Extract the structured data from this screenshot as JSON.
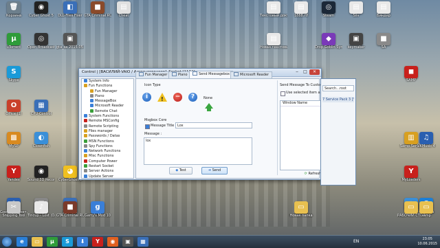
{
  "desktop": {
    "icons": [
      {
        "label": "Корзина",
        "color": "#6d7f8c",
        "glyph": "🗑"
      },
      {
        "label": "Cyber Ghost 5",
        "color": "#222222",
        "glyph": "◉"
      },
      {
        "label": "DLL-Files Fixer",
        "color": "#3a6fb8",
        "glyph": "◧"
      },
      {
        "label": "GTA Criminal RUSSIA",
        "color": "#8a4a2a",
        "glyph": "■"
      },
      {
        "label": "Cheat",
        "color": "#e0e0e0",
        "glyph": "▤"
      },
      {
        "label": "uTorrent",
        "color": "#2f9c3a",
        "glyph": "µ"
      },
      {
        "label": "Skype",
        "color": "#1a9ad8",
        "glyph": "S"
      },
      {
        "label": "Open Broadcast...",
        "color": "#333333",
        "glyph": "◎"
      },
      {
        "label": "gta_sa 2015-05-01 ...",
        "color": "#555555",
        "glyph": "▣"
      },
      {
        "label": "Office (1)",
        "color": "#c9402a",
        "glyph": "O"
      },
      {
        "label": "CPU-Control",
        "color": "#3a6fb8",
        "glyph": "▦"
      },
      {
        "label": "MySP",
        "color": "#d88a20",
        "glyph": "▩"
      },
      {
        "label": "Clownfish",
        "color": "#3a8fd8",
        "glyph": "◐"
      },
      {
        "label": "Yandex",
        "color": "#c8201c",
        "glyph": "Y"
      },
      {
        "label": "Sound 3D Record",
        "color": "#222222",
        "glyph": "◉"
      },
      {
        "label": "CyberGhost 5",
        "color": "#f0c020",
        "glyph": "◕"
      },
      {
        "label": "Google Планет...",
        "color": "#2a5fb0",
        "glyph": "◍"
      },
      {
        "label": "m1dge",
        "color": "#888888",
        "glyph": "■"
      },
      {
        "label": "JetBoost",
        "color": "#3a6fb8",
        "glyph": "➤"
      },
      {
        "label": "Snipping Tool",
        "color": "#c8c8c8",
        "glyph": "✂"
      },
      {
        "label": "Tincup - Lost (Original M...",
        "color": "#e8e8e8",
        "glyph": "♪"
      },
      {
        "label": "GTA Criminal RUSSIA.exe",
        "color": "#7a3a2a",
        "glyph": "■"
      },
      {
        "label": "Garry's Mod 10",
        "color": "#3a7fd8",
        "glyph": "g"
      },
      {
        "label": "Текстовый документ...",
        "color": "#e8e8e8",
        "glyph": "▤"
      },
      {
        "label": "Новая текстовый...",
        "color": "#e8e8e8",
        "glyph": "▤"
      },
      {
        "label": "1888.rtf",
        "color": "#e8e8e8",
        "glyph": "▤"
      },
      {
        "label": "Steam",
        "color": "#1b2838",
        "glyph": "◎"
      },
      {
        "label": "Drop Goblin Synchronic...",
        "color": "#7a3ab8",
        "glyph": "◆"
      },
      {
        "label": "keymaker",
        "color": "#444444",
        "glyph": "▣"
      },
      {
        "label": "SA",
        "color": "#8a8a8a",
        "glyph": "■"
      },
      {
        "label": "Siiv",
        "color": "#e8e8e8",
        "glyph": "▤"
      },
      {
        "label": "Биндер",
        "color": "#e8e8e8",
        "glyph": "▤"
      },
      {
        "label": "SAMP",
        "color": "#c8201c",
        "glyph": "◼"
      },
      {
        "label": "Samp Server",
        "color": "#d8a020",
        "glyph": "▥"
      },
      {
        "label": "MyLoaders",
        "color": "#c8201c",
        "glyph": "Y"
      },
      {
        "label": "Wifi",
        "color": "#3a8fd8",
        "glyph": "◈"
      },
      {
        "label": "VKMusic 4",
        "color": "#2a5fb0",
        "glyph": "♫"
      },
      {
        "label": "@mail.ru",
        "color": "#1a7fd8",
        "glyph": "@"
      },
      {
        "label": "Новая папка",
        "color": "#e8c050",
        "glyph": "▭"
      },
      {
        "label": "РАБОЧИЙ СТОЛ",
        "color": "#e8c050",
        "glyph": "▭"
      },
      {
        "label": "samp",
        "color": "#e8c050",
        "glyph": "▭"
      }
    ]
  },
  "window": {
    "title": "Control | [ВАСИЛИЙ-VAIO / Администратор]_Socket [1184]",
    "min_glyph": "‒",
    "max_glyph": "□",
    "close_glyph": "✕",
    "tree": [
      {
        "label": "System Info",
        "level": 0,
        "color": "#3a7fd8"
      },
      {
        "label": "Fun Functions",
        "level": 0,
        "color": "#d8a020"
      },
      {
        "label": "Fun Manager",
        "level": 1,
        "color": "#d8a020"
      },
      {
        "label": "Piano",
        "level": 1,
        "color": "#888888"
      },
      {
        "label": "MessageBox",
        "level": 1,
        "color": "#3a7fd8"
      },
      {
        "label": "Microsoft Reader",
        "level": 1,
        "color": "#3a7fd8"
      },
      {
        "label": "Remote Chat",
        "level": 1,
        "color": "#3a9f3a"
      },
      {
        "label": "System Functions",
        "level": 0,
        "color": "#3a7fd8"
      },
      {
        "label": "Remote MSConfig",
        "level": 0,
        "color": "#c8201c"
      },
      {
        "label": "Remote Scripting",
        "level": 0,
        "color": "#888888"
      },
      {
        "label": "Files manager",
        "level": 0,
        "color": "#d8a020"
      },
      {
        "label": "Passwords / Datas",
        "level": 0,
        "color": "#d8a020"
      },
      {
        "label": "MSN Functions",
        "level": 0,
        "color": "#3a9f3a"
      },
      {
        "label": "Spy Functions",
        "level": 0,
        "color": "#888888"
      },
      {
        "label": "Network Functions",
        "level": 0,
        "color": "#3a7fd8"
      },
      {
        "label": "Misc Functions",
        "level": 0,
        "color": "#d8a020"
      },
      {
        "label": "Computer Power",
        "level": 0,
        "color": "#c8201c"
      },
      {
        "label": "Restart Socket",
        "level": 0,
        "color": "#3a9f3a"
      },
      {
        "label": "Server Actions",
        "level": 0,
        "color": "#888888"
      },
      {
        "label": "Update Server",
        "level": 0,
        "color": "#3a7fd8"
      }
    ],
    "tabs": [
      "Fun Manager",
      "Piano",
      "Send Messagebox",
      "Microsoft Reader"
    ],
    "active_tab": 2,
    "panel": {
      "icon_type_label": "Icon Type",
      "icons": [
        "i",
        "!",
        "−",
        "?"
      ],
      "none_label": "None",
      "msgbox_core_label": "Msgbox Core",
      "message_title_label": "Message Title :",
      "message_title_value": "Lox",
      "message_label": "Message :",
      "message_value": "lox",
      "test_label": "Test",
      "send_label": "Send",
      "custom_window_label": "Send Message To Custom Window",
      "use_selected_label": "Use selected item as message window",
      "window_name_header": "Window Name",
      "refresh_label": "Refresh"
    }
  },
  "window2": {
    "search_value": "Search...root",
    "item": "7 Service Pack 3 [Y"
  },
  "taskbar": {
    "lang": "EN",
    "time": "23:05",
    "date": "10.06.2015",
    "apps": [
      {
        "glyph": "e",
        "color": "#2a7fd8"
      },
      {
        "glyph": "▭",
        "color": "#e8c050"
      },
      {
        "glyph": "µ",
        "color": "#2f9c3a"
      },
      {
        "glyph": "S",
        "color": "#1a9ad8"
      },
      {
        "glyph": "⬇",
        "color": "#3a7fd8"
      },
      {
        "glyph": "Y",
        "color": "#c8201c"
      },
      {
        "glyph": "◉",
        "color": "#e06020"
      },
      {
        "glyph": "▣",
        "color": "#555555"
      },
      {
        "glyph": "▦",
        "color": "#3a6fb8"
      }
    ]
  }
}
